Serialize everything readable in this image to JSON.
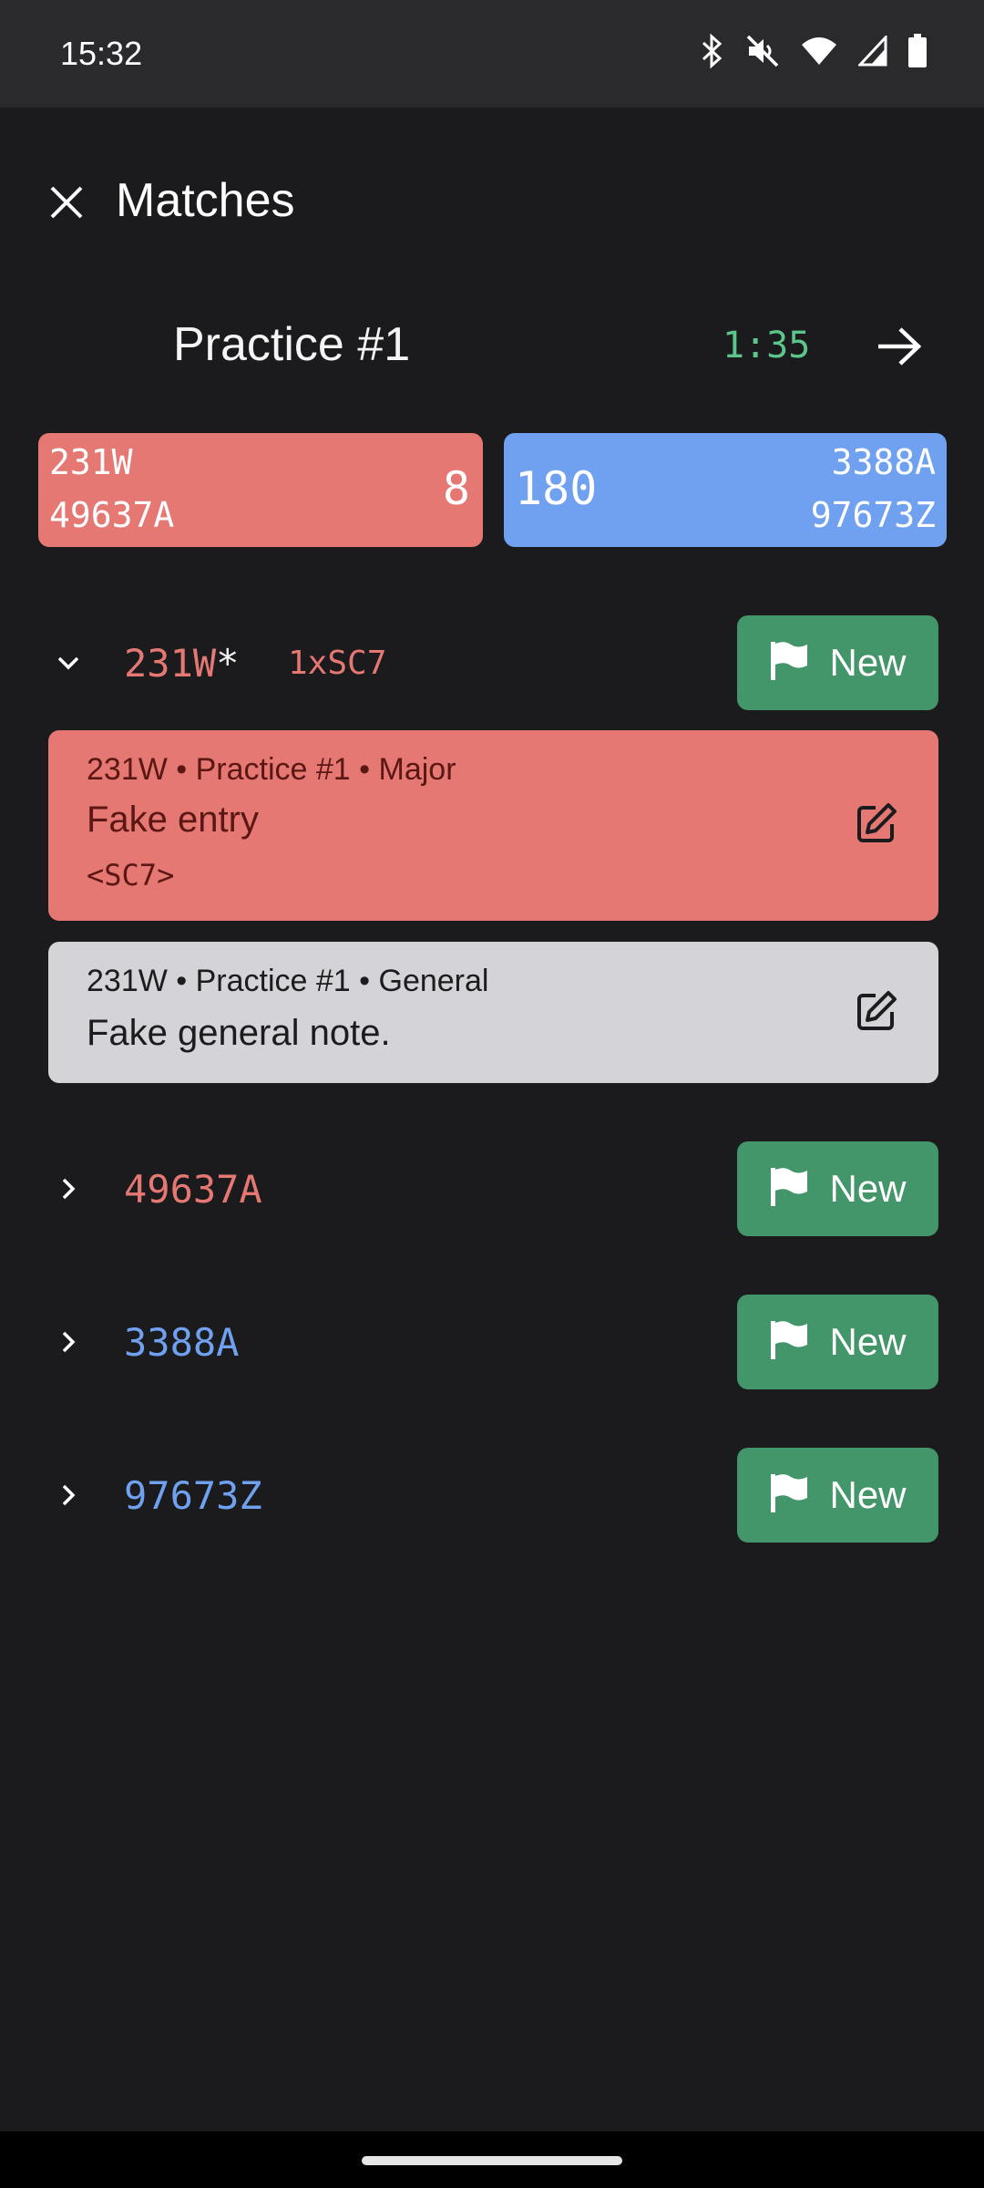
{
  "status_bar": {
    "time": "15:32",
    "icons": [
      "bluetooth-icon",
      "mute-icon",
      "wifi-icon",
      "signal-icon",
      "battery-icon"
    ]
  },
  "app_bar": {
    "title": "Matches",
    "close_icon": "close-icon"
  },
  "match": {
    "title": "Practice #1",
    "timer": "1:35",
    "next_icon": "arrow-right-icon"
  },
  "alliances": {
    "red": {
      "teams": [
        "231W",
        "49637A"
      ],
      "score": "8",
      "color": "#e57872"
    },
    "blue": {
      "teams": [
        "3388A",
        "97673Z"
      ],
      "score": "180",
      "color": "#6fa1f0"
    }
  },
  "team_rows": [
    {
      "team": "231W",
      "alliance": "red",
      "expanded": true,
      "star": "*",
      "penalties": "1xSC7",
      "button_label": "New"
    },
    {
      "team": "49637A",
      "alliance": "red",
      "expanded": false,
      "star": "",
      "penalties": "",
      "button_label": "New"
    },
    {
      "team": "3388A",
      "alliance": "blue",
      "expanded": false,
      "star": "",
      "penalties": "",
      "button_label": "New"
    },
    {
      "team": "97673Z",
      "alliance": "blue",
      "expanded": false,
      "star": "",
      "penalties": "",
      "button_label": "New"
    }
  ],
  "notes": [
    {
      "meta": "231W • Practice #1 • Major",
      "text": "Fake entry",
      "code": "<SC7>",
      "type": "major"
    },
    {
      "meta": "231W • Practice #1 • General",
      "text": "Fake general note.",
      "code": "",
      "type": "general"
    }
  ],
  "colors": {
    "background": "#1b1b1d",
    "accent_green": "#43956a",
    "timer_green": "#5cc58a"
  }
}
